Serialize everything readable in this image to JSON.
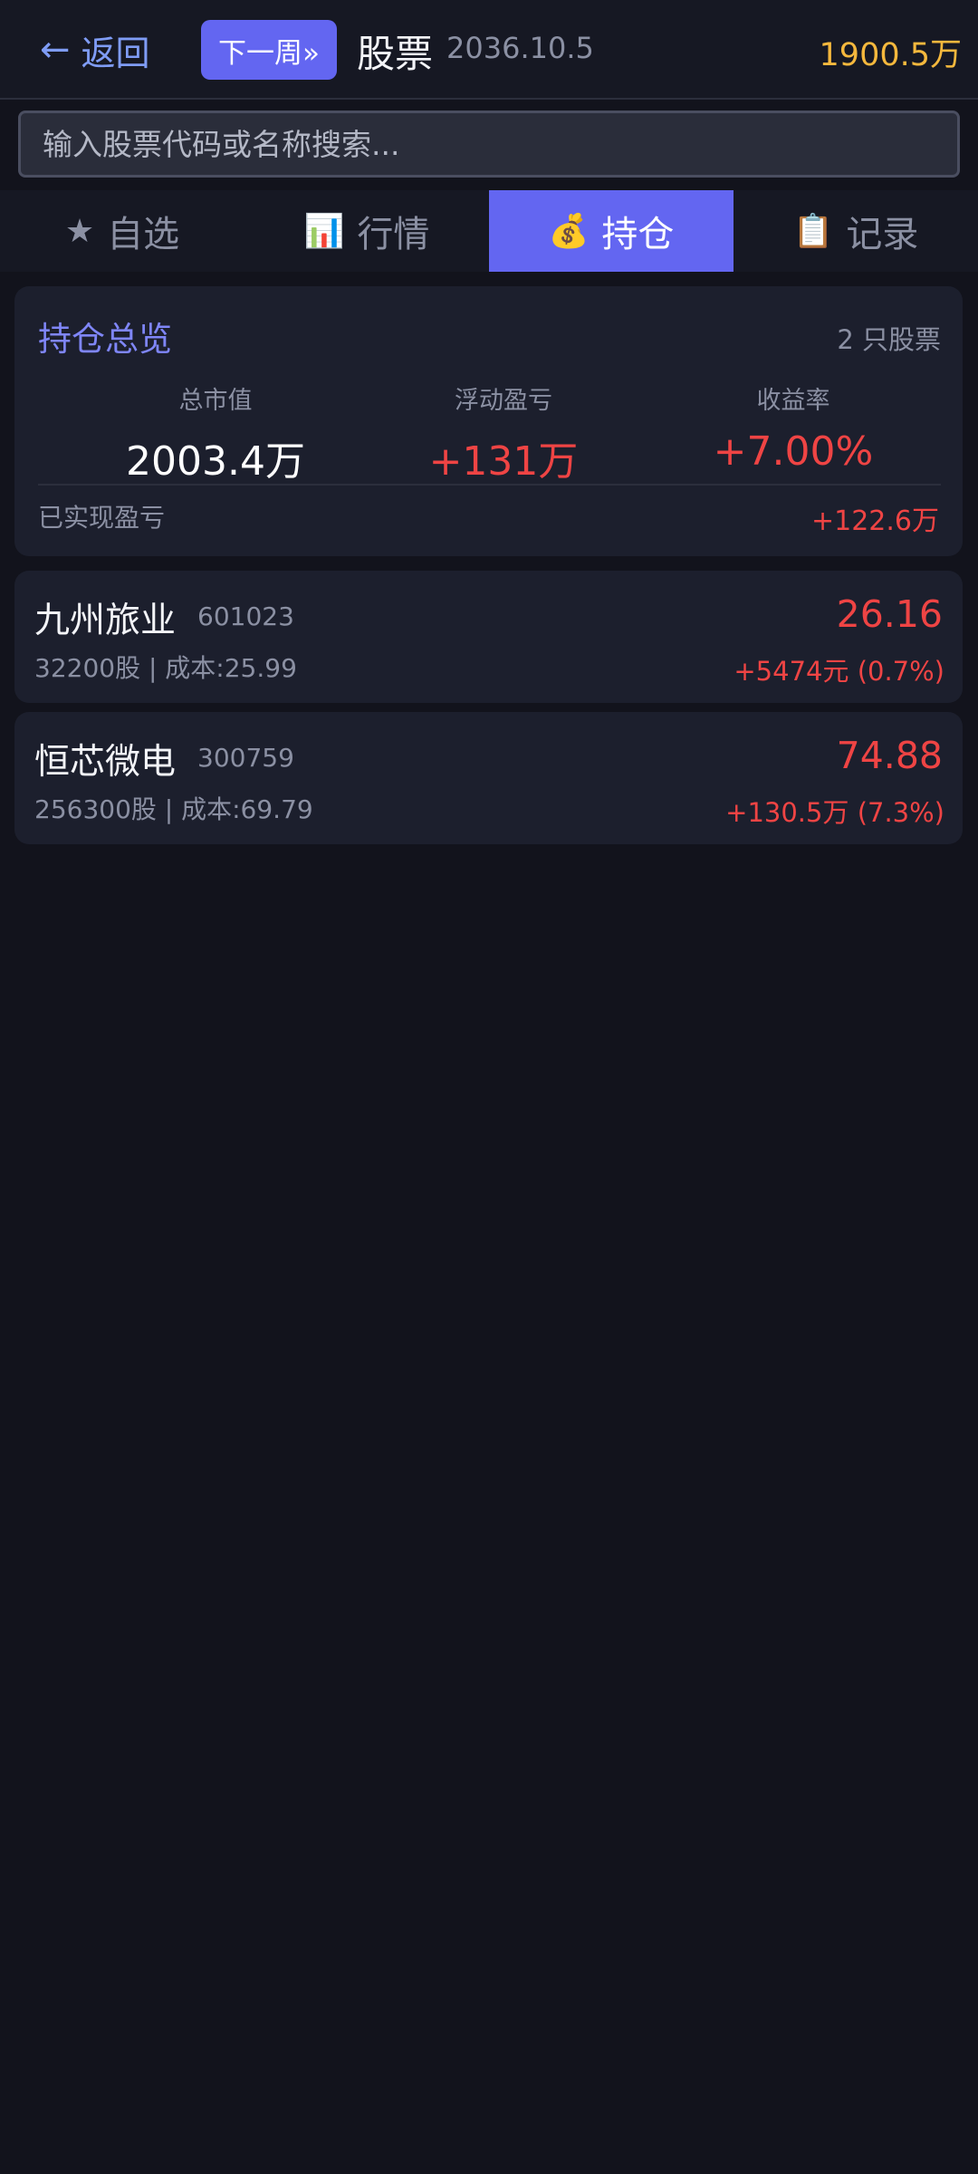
{
  "header": {
    "back_arrow": "←",
    "back_label": "返回",
    "next_week_label": "下一周»",
    "title": "股票",
    "date": "2036.10.5",
    "balance": "1900.5万"
  },
  "search": {
    "placeholder": "输入股票代码或名称搜索..."
  },
  "tabs": [
    {
      "icon": "★",
      "label": "自选",
      "icon_name": "star-icon",
      "active": false
    },
    {
      "icon": "📊",
      "label": "行情",
      "icon_name": "bar-chart-icon",
      "active": false
    },
    {
      "icon": "💰",
      "label": "持仓",
      "icon_name": "money-bag-icon",
      "active": true
    },
    {
      "icon": "📋",
      "label": "记录",
      "icon_name": "clipboard-icon",
      "active": false
    }
  ],
  "summary": {
    "title": "持仓总览",
    "count": "2 只股票",
    "total_value_label": "总市值",
    "total_value": "2003.4万",
    "floating_pnl_label": "浮动盈亏",
    "floating_pnl": "+131万",
    "return_rate_label": "收益率",
    "return_rate": "+7.00%",
    "realized_pnl_label": "已实现盈亏",
    "realized_pnl": "+122.6万"
  },
  "holdings": [
    {
      "name": "九州旅业",
      "code": "601023",
      "info": "32200股 | 成本:25.99",
      "price": "26.16",
      "pnl": "+5474元 (0.7%)"
    },
    {
      "name": "恒芯微电",
      "code": "300759",
      "info": "256300股 | 成本:69.79",
      "price": "74.88",
      "pnl": "+130.5万 (7.3%)"
    }
  ],
  "colors": {
    "accent": "#6366f1",
    "up_red": "#ef4444",
    "balance_gold": "#f5b83d",
    "background": "#12131c"
  }
}
